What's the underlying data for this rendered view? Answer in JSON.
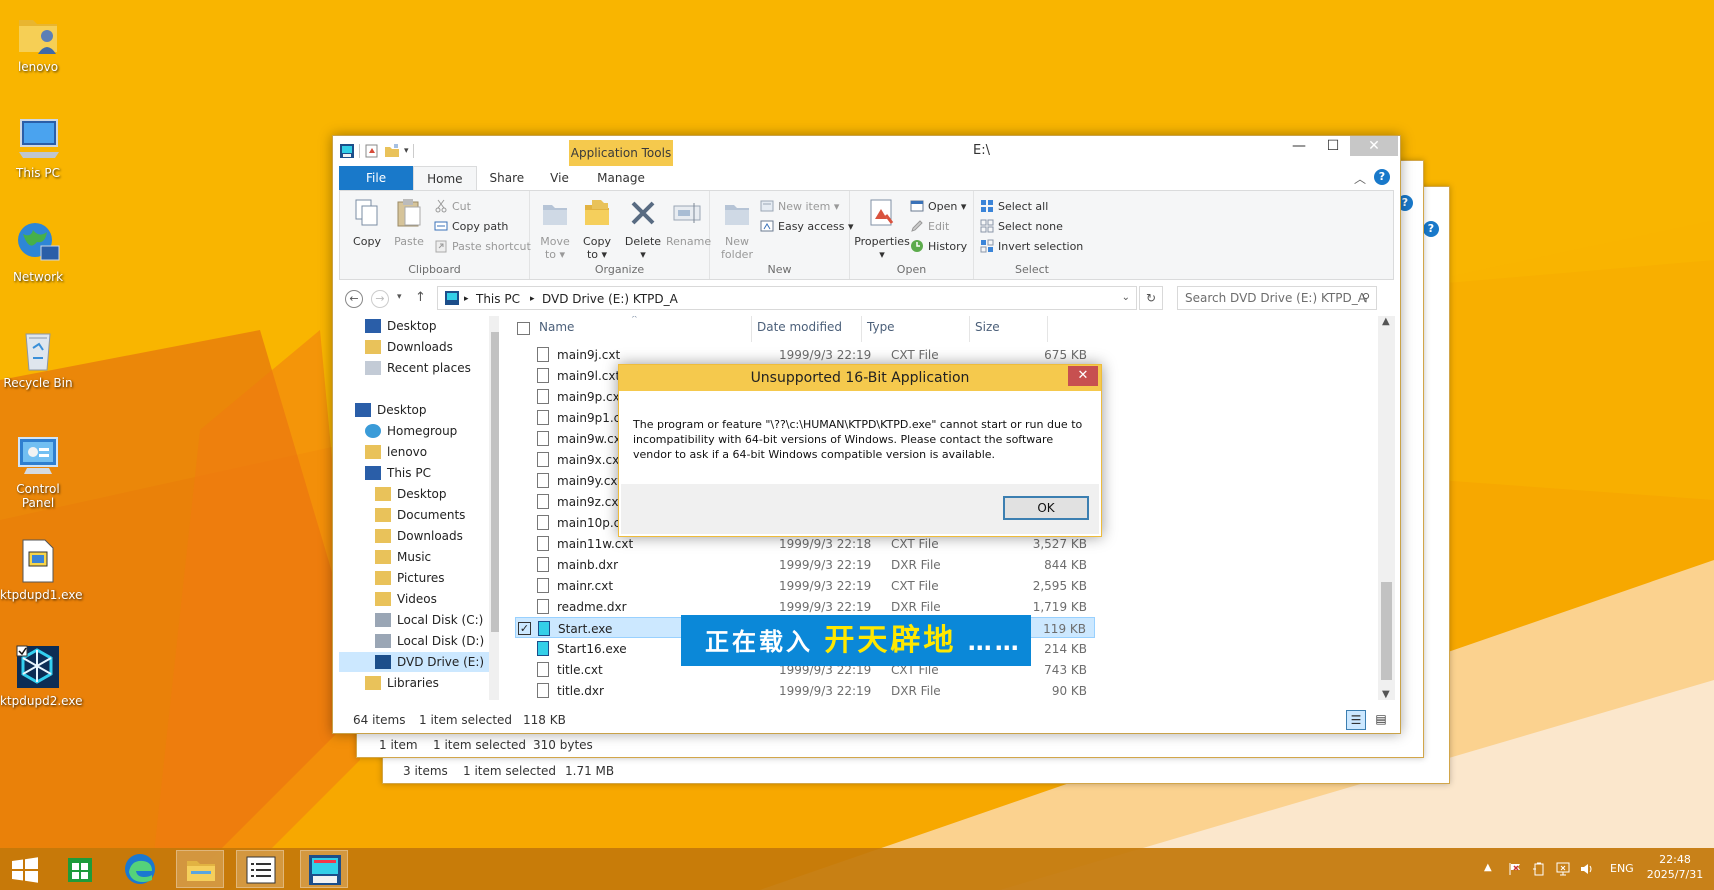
{
  "desktop": {
    "icons": [
      {
        "label": "lenovo"
      },
      {
        "label": "This PC"
      },
      {
        "label": "Network"
      },
      {
        "label": "Recycle Bin"
      },
      {
        "label": "Control Panel"
      },
      {
        "label": "ktpdupd1.exe"
      },
      {
        "label": "ktpdupd2.exe"
      }
    ]
  },
  "back_windows": {
    "window2_status": {
      "items": "1 item",
      "selected": "1 item selected",
      "size": "310 bytes"
    },
    "window3_status": {
      "items": "3 items",
      "selected": "1 item selected",
      "size": "1.71 MB"
    }
  },
  "explorer": {
    "title": "E:\\",
    "contextual_tab": "Application Tools",
    "tabs": [
      "File",
      "Home",
      "Share",
      "View",
      "Manage"
    ],
    "ribbon": {
      "clipboard": {
        "label": "Clipboard",
        "copy": "Copy",
        "paste": "Paste",
        "cut": "Cut",
        "copy_path": "Copy path",
        "paste_shortcut": "Paste shortcut"
      },
      "organize": {
        "label": "Organize",
        "move_to": "Move",
        "move_to2": "to ▾",
        "copy_to": "Copy",
        "copy_to2": "to ▾",
        "delete": "Delete",
        "delete2": "▾",
        "rename": "Rename"
      },
      "new": {
        "label": "New",
        "new_folder": "New",
        "new_folder2": "folder",
        "new_item": "New item ▾",
        "easy_access": "Easy access ▾"
      },
      "open": {
        "label": "Open",
        "properties": "Properties",
        "properties2": "▾",
        "open": "Open ▾",
        "edit": "Edit",
        "history": "History"
      },
      "select": {
        "label": "Select",
        "select_all": "Select all",
        "select_none": "Select none",
        "invert": "Invert selection"
      }
    },
    "address": {
      "this_pc": "This PC",
      "drive": "DVD Drive (E:) KTPD_A"
    },
    "search_placeholder": "Search DVD Drive (E:) KTPD_A",
    "nav": [
      {
        "label": "Desktop"
      },
      {
        "label": "Downloads"
      },
      {
        "label": "Recent places"
      },
      {
        "label": "Desktop"
      },
      {
        "label": "Homegroup"
      },
      {
        "label": "lenovo"
      },
      {
        "label": "This PC"
      },
      {
        "label": "Desktop"
      },
      {
        "label": "Documents"
      },
      {
        "label": "Downloads"
      },
      {
        "label": "Music"
      },
      {
        "label": "Pictures"
      },
      {
        "label": "Videos"
      },
      {
        "label": "Local Disk (C:)"
      },
      {
        "label": "Local Disk (D:)"
      },
      {
        "label": "DVD Drive (E:) K"
      },
      {
        "label": "Libraries"
      }
    ],
    "columns": {
      "name": "Name",
      "date": "Date modified",
      "type": "Type",
      "size": "Size"
    },
    "files": [
      {
        "name": "main9j.cxt",
        "date": "1999/9/3 22:19",
        "type": "CXT File",
        "size": "675 KB"
      },
      {
        "name": "main9l.cxt",
        "date": "",
        "type": "",
        "size": ""
      },
      {
        "name": "main9p.cxt",
        "date": "",
        "type": "",
        "size": ""
      },
      {
        "name": "main9p1.cxt",
        "date": "",
        "type": "",
        "size": ""
      },
      {
        "name": "main9w.cxt",
        "date": "",
        "type": "",
        "size": ""
      },
      {
        "name": "main9x.cxt",
        "date": "",
        "type": "",
        "size": ""
      },
      {
        "name": "main9y.cxt",
        "date": "",
        "type": "",
        "size": ""
      },
      {
        "name": "main9z.cxt",
        "date": "",
        "type": "",
        "size": ""
      },
      {
        "name": "main10p.cxt",
        "date": "",
        "type": "",
        "size": ""
      },
      {
        "name": "main11w.cxt",
        "date": "1999/9/3 22:18",
        "type": "CXT File",
        "size": "3,527 KB"
      },
      {
        "name": "mainb.dxr",
        "date": "1999/9/3 22:19",
        "type": "DXR File",
        "size": "844 KB"
      },
      {
        "name": "mainr.cxt",
        "date": "1999/9/3 22:19",
        "type": "CXT File",
        "size": "2,595 KB"
      },
      {
        "name": "readme.dxr",
        "date": "1999/9/3 22:19",
        "type": "DXR File",
        "size": "1,719 KB"
      },
      {
        "name": "Start.exe",
        "date": "",
        "type": "",
        "size": "119 KB"
      },
      {
        "name": "Start16.exe",
        "date": "",
        "type": "",
        "size": "214 KB"
      },
      {
        "name": "title.cxt",
        "date": "1999/9/3 22:19",
        "type": "CXT File",
        "size": "743 KB"
      },
      {
        "name": "title.dxr",
        "date": "1999/9/3 22:19",
        "type": "DXR File",
        "size": "90 KB"
      }
    ],
    "status": {
      "items": "64 items",
      "selected": "1 item selected",
      "size": "118 KB"
    }
  },
  "splash": {
    "text1": "正在载入",
    "text2": "开天辟地",
    "text3": "……"
  },
  "dialog": {
    "title": "Unsupported 16-Bit Application",
    "message": "The program or feature \"\\??\\c:\\HUMAN\\KTPD\\KTPD.exe\" cannot start or run due to incompatibility with 64-bit versions of Windows. Please contact the software vendor to ask if a 64-bit Windows compatible version is available.",
    "ok": "OK"
  },
  "taskbar": {
    "lang": "ENG",
    "time": "22:48",
    "date": "2025/7/31"
  }
}
